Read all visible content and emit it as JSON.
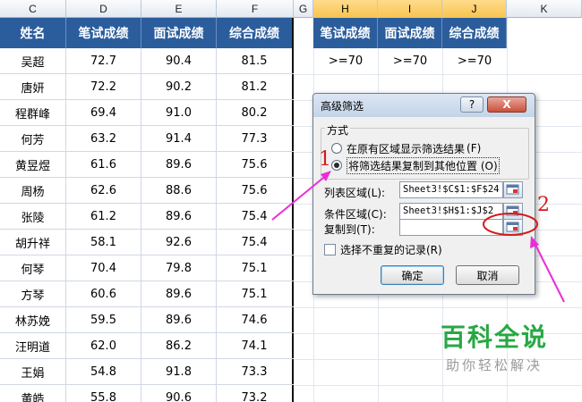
{
  "columns": [
    "C",
    "D",
    "E",
    "F",
    "G",
    "H",
    "I",
    "J",
    "K"
  ],
  "table": {
    "headers": [
      "姓名",
      "笔试成绩",
      "面试成绩",
      "综合成绩"
    ],
    "rows": [
      [
        "吴超",
        "72.7",
        "90.4",
        "81.5"
      ],
      [
        "唐妍",
        "72.2",
        "90.2",
        "81.2"
      ],
      [
        "程群峰",
        "69.4",
        "91.0",
        "80.2"
      ],
      [
        "何芳",
        "63.2",
        "91.4",
        "77.3"
      ],
      [
        "黄昱煜",
        "61.6",
        "89.6",
        "75.6"
      ],
      [
        "周杨",
        "62.6",
        "88.6",
        "75.6"
      ],
      [
        "张陵",
        "61.2",
        "89.6",
        "75.4"
      ],
      [
        "胡升祥",
        "58.1",
        "92.6",
        "75.4"
      ],
      [
        "何琴",
        "70.4",
        "79.8",
        "75.1"
      ],
      [
        "方琴",
        "60.6",
        "89.6",
        "75.1"
      ],
      [
        "林苏娩",
        "59.5",
        "89.6",
        "74.6"
      ],
      [
        "汪明道",
        "62.0",
        "86.2",
        "74.1"
      ],
      [
        "王娟",
        "54.8",
        "91.8",
        "73.3"
      ],
      [
        "黄皓",
        "55.8",
        "90.6",
        "73.2"
      ]
    ]
  },
  "criteria": {
    "headers": [
      "笔试成绩",
      "面试成绩",
      "综合成绩"
    ],
    "values": [
      ">=70",
      ">=70",
      ">=70"
    ]
  },
  "dialog": {
    "title": "高级筛选",
    "help": "?",
    "close": "X",
    "mode_legend": "方式",
    "option1": "在原有区域显示筛选结果",
    "option1_key": "(F)",
    "option2": "将筛选结果复制到其他位置",
    "option2_key": "(O)",
    "list_label": "列表区域(L):",
    "list_value": "Sheet3!$C$1:$F$24",
    "criteria_label": "条件区域(C):",
    "criteria_value": "Sheet3!$H$1:$J$2",
    "copy_label": "复制到(T):",
    "copy_value": "",
    "unique_label": "选择不重复的记录(R)",
    "ok": "确定",
    "cancel": "取消"
  },
  "annotations": {
    "step1": "1",
    "step2": "2"
  },
  "watermark": {
    "main": "百科全说",
    "sub": "助你轻松解决"
  },
  "colors": {
    "header_bg": "#2b5d9c",
    "annotation": "#d21b1b",
    "watermark": "#27a844"
  }
}
